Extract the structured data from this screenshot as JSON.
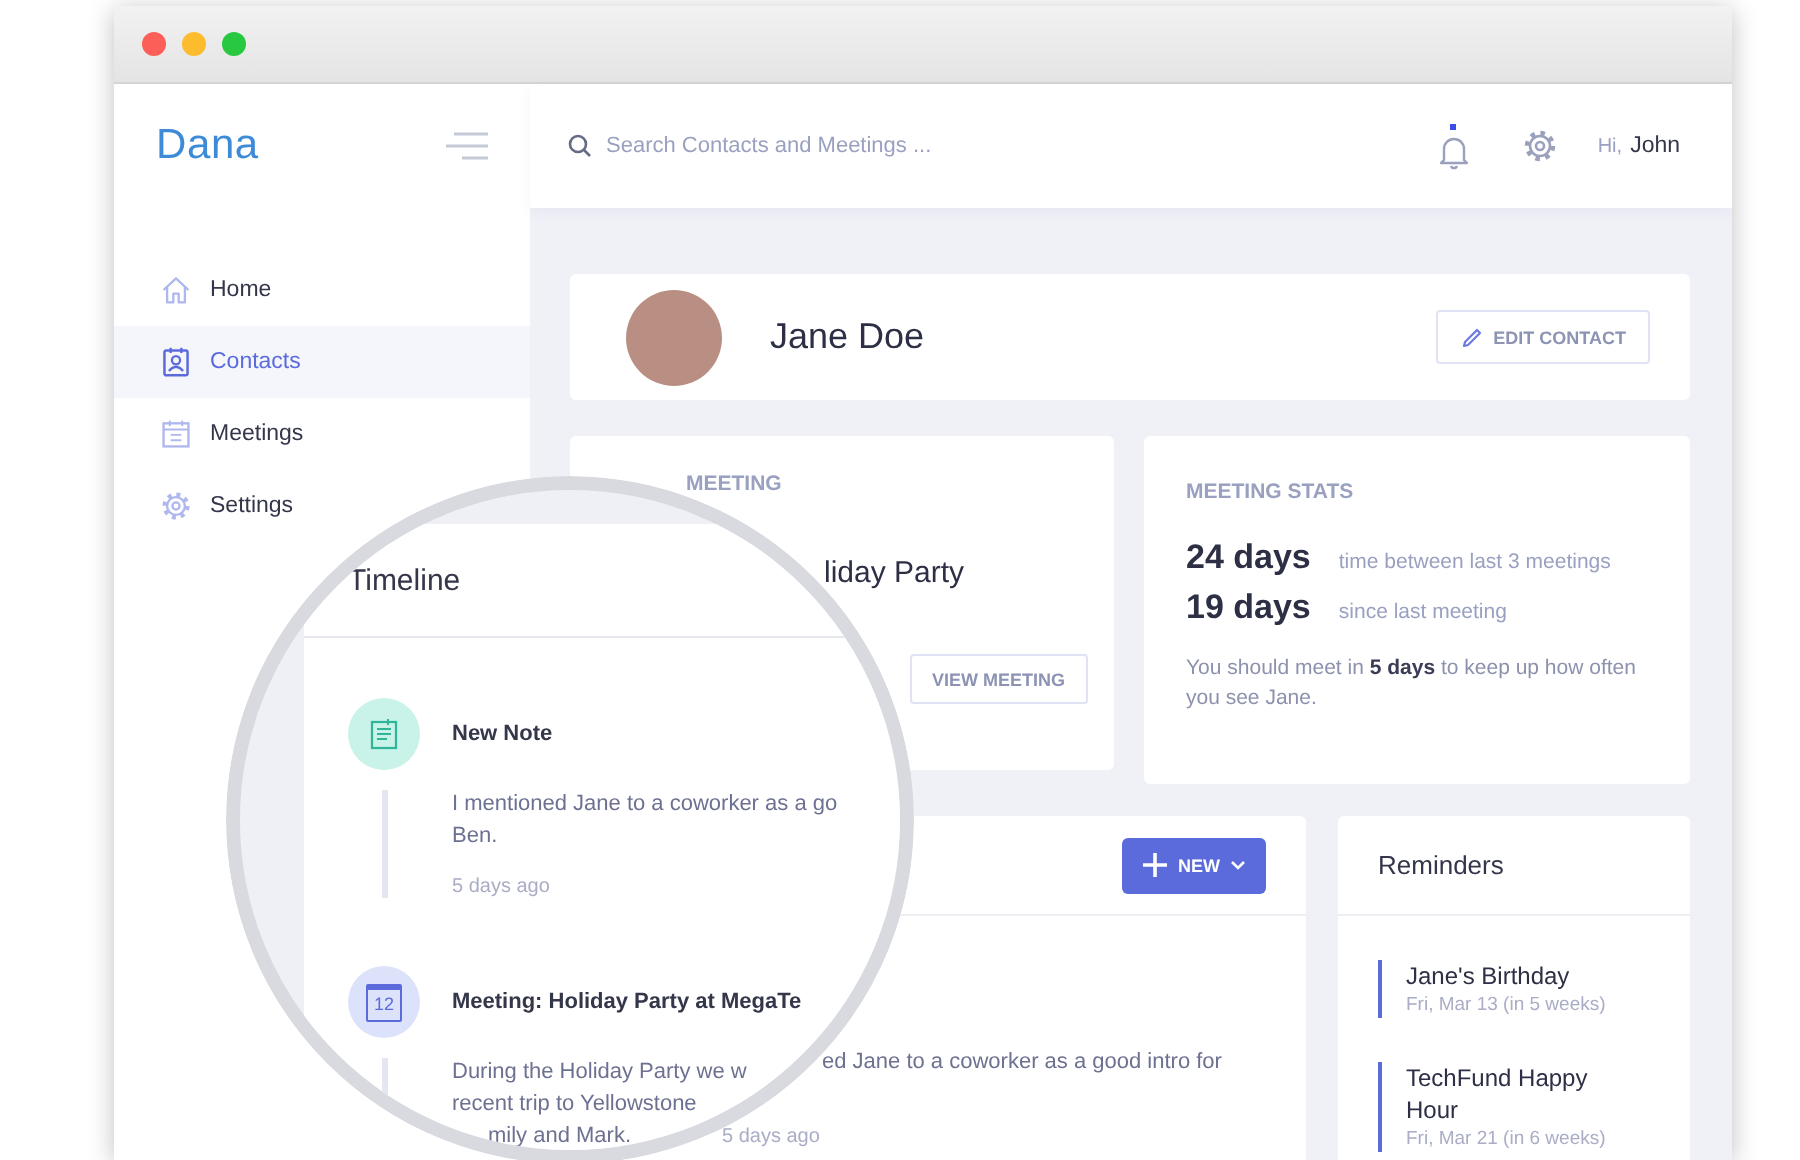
{
  "sidebar": {
    "logo": "Dana",
    "items": [
      {
        "kind": "home",
        "label": "Home",
        "selected": false
      },
      {
        "kind": "contacts",
        "label": "Contacts",
        "selected": true
      },
      {
        "kind": "meetings",
        "label": "Meetings",
        "selected": false
      },
      {
        "kind": "settings",
        "label": "Settings",
        "selected": false
      }
    ]
  },
  "topbar": {
    "search": {
      "placeholder": "Search Contacts and Meetings ..."
    },
    "notification_dot": true,
    "greeting": "Hi,",
    "user": "John"
  },
  "profile": {
    "name": "Jane Doe",
    "edit_button": "EDIT CONTACT"
  },
  "upcoming_meeting": {
    "heading": "MEETING",
    "title": "liday Party",
    "button": "VIEW MEETING"
  },
  "meeting_stats": {
    "heading": "MEETING STATS",
    "stats": [
      {
        "value": "24 days",
        "caption": "time between last 3 meetings"
      },
      {
        "value": "19 days",
        "caption": "since last meeting"
      }
    ],
    "advice": "You should meet in **5 days** to keep up how often you see Jane."
  },
  "timeline": {
    "new_button": "NEW",
    "visible_text": "ed Jane to a coworker as a good intro for",
    "visible_time": "5 days ago"
  },
  "reminders": {
    "title": "Reminders",
    "items": [
      {
        "title": "Jane's Birthday",
        "date": "Fri, Mar 13 (in 5 weeks)"
      },
      {
        "title": "TechFund Happy Hour",
        "date": "Fri, Mar 21 (in 6 weeks)"
      }
    ]
  },
  "magnifier": {
    "title": "Timeline",
    "entries": [
      {
        "kind": "note",
        "title": "New Note",
        "lines": [
          "I mentioned Jane to a coworker as a go",
          "Ben."
        ],
        "time": "5 days ago"
      },
      {
        "kind": "meeting",
        "icon_text": "12",
        "title": "Meeting: Holiday Party at MegaTe",
        "lines": [
          "During the Holiday Party we w",
          "recent trip to Yellowstone",
          "mily and Mark."
        ]
      }
    ]
  }
}
